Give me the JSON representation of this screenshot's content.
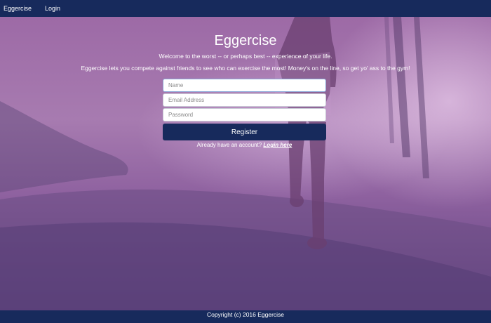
{
  "nav": {
    "brand": "Eggercise",
    "login": "Login"
  },
  "hero": {
    "title": "Eggercise",
    "tagline": "Welcome to the worst -- or perhaps best -- experience of your life.",
    "description": "Eggercise lets you compete against friends to see who can exercise the most! Money's on the line, so get yo' ass to the gym!"
  },
  "form": {
    "name_placeholder": "Name",
    "email_placeholder": "Email Address",
    "password_placeholder": "Password",
    "register_label": "Register",
    "login_prompt": "Already have an account?",
    "login_link": "Login here"
  },
  "footer": {
    "copyright": "Copyright (c) 2016 Eggercise"
  },
  "colors": {
    "navbar": "#172a5c",
    "button": "#172a5c",
    "background_tint": "#9d6aa6"
  }
}
